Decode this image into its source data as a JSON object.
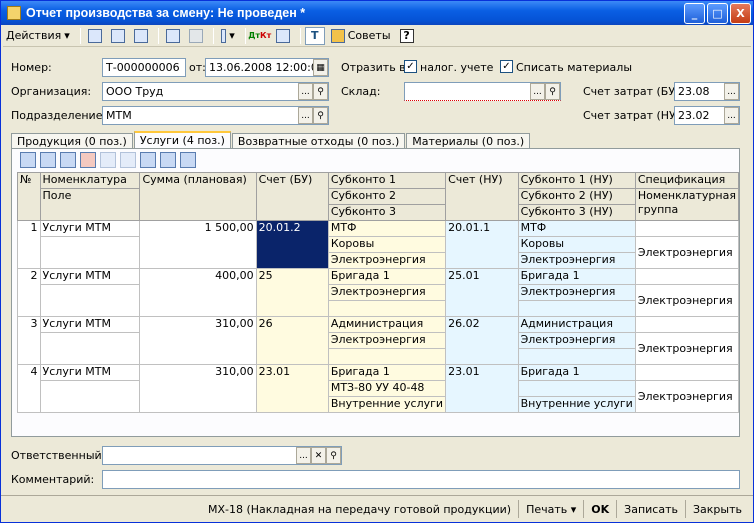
{
  "window": {
    "title": "Отчет производства за смену: Не проведен *",
    "min": "_",
    "max": "□",
    "close": "X"
  },
  "toolbar": {
    "actions": "Действия",
    "tips": "Советы",
    "help": "?"
  },
  "form": {
    "number_label": "Номер:",
    "number": "Т-000000006",
    "date_label": "от:",
    "date": "13.06.2008 12:00:00",
    "reflect_label": "Отразить в:",
    "tax_label": "налог. учете",
    "writeoff_label": "Списать материалы",
    "org_label": "Организация:",
    "org": "ООО Труд",
    "warehouse_label": "Склад:",
    "warehouse": "",
    "cost_bu_label": "Счет затрат (БУ):",
    "cost_bu": "23.08",
    "dept_label": "Подразделение:",
    "dept": "МТМ",
    "cost_nu_label": "Счет затрат (НУ):",
    "cost_nu": "23.02",
    "resp_label": "Ответственный:",
    "resp": "",
    "comment_label": "Комментарий:",
    "comment": ""
  },
  "tabs": [
    "Продукция (0 поз.)",
    "Услуги (4 поз.)",
    "Возвратные отходы (0 поз.)",
    "Материалы (0 поз.)"
  ],
  "grid": {
    "headers": {
      "num": "№",
      "nom": "Номенклатура",
      "field": "Поле",
      "sum": "Сумма (плановая)",
      "acc_bu": "Счет (БУ)",
      "sub1": "Субконто 1",
      "sub2": "Субконто 2",
      "sub3": "Субконто 3",
      "acc_nu": "Счет (НУ)",
      "sub1nu": "Субконто 1 (НУ)",
      "sub2nu": "Субконто 2 (НУ)",
      "sub3nu": "Субконто 3 (НУ)",
      "spec": "Спецификация",
      "nomgroup": "Номенклатурная группа"
    },
    "rows": [
      {
        "n": "1",
        "nom": "Услуги МТМ",
        "sum": "1 500,00",
        "acc": "20.01.2",
        "s1": "МТФ",
        "s2": "Коровы",
        "s3": "Электроэнергия",
        "accnu": "20.01.1",
        "n1": "МТФ",
        "n2": "Коровы",
        "n3": "Электроэнергия",
        "spec": "",
        "grp": "Электроэнергия"
      },
      {
        "n": "2",
        "nom": "Услуги МТМ",
        "sum": "400,00",
        "acc": "25",
        "s1": "Бригада 1",
        "s2": "Электроэнергия",
        "s3": "",
        "accnu": "25.01",
        "n1": "Бригада 1",
        "n2": "Электроэнергия",
        "n3": "",
        "spec": "",
        "grp": "Электроэнергия"
      },
      {
        "n": "3",
        "nom": "Услуги МТМ",
        "sum": "310,00",
        "acc": "26",
        "s1": "Администрация",
        "s2": "Электроэнергия",
        "s3": "",
        "accnu": "26.02",
        "n1": "Администрация",
        "n2": "Электроэнергия",
        "n3": "",
        "spec": "",
        "grp": "Электроэнергия"
      },
      {
        "n": "4",
        "nom": "Услуги МТМ",
        "sum": "310,00",
        "acc": "23.01",
        "s1": "Бригада 1",
        "s2": "МТЗ-80 УУ 40-48",
        "s3": "Внутренние услуги",
        "accnu": "23.01",
        "n1": "Бригада 1",
        "n2": "",
        "n3": "Внутренние услуги",
        "spec": "",
        "grp": "Электроэнергия"
      }
    ]
  },
  "footer": {
    "mx18": "МХ-18 (Накладная на передачу готовой продукции)",
    "print": "Печать",
    "ok": "OK",
    "save": "Записать",
    "close": "Закрыть"
  }
}
